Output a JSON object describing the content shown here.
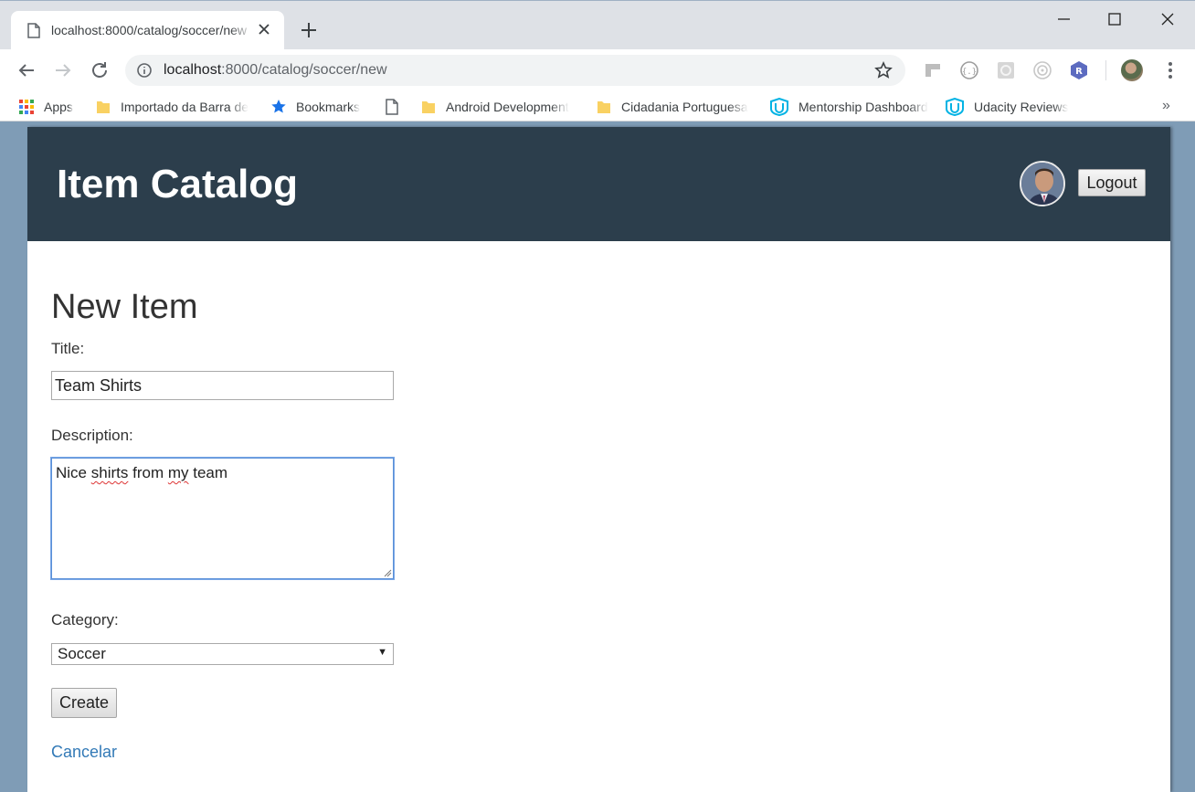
{
  "browser": {
    "tab_title": "localhost:8000/catalog/soccer/new",
    "url_host": "localhost",
    "url_rest": ":8000/catalog/soccer/new"
  },
  "bookmarks": [
    {
      "label": "Apps",
      "icon": "apps-grid-icon"
    },
    {
      "label": "Importado da Barra de",
      "icon": "folder-icon"
    },
    {
      "label": "Bookmarks",
      "icon": "star-icon"
    },
    {
      "label": "",
      "icon": "page-icon"
    },
    {
      "label": "Android Development",
      "icon": "folder-icon"
    },
    {
      "label": "Cidadania Portuguesa",
      "icon": "folder-icon"
    },
    {
      "label": "Mentorship Dashboard",
      "icon": "udacity-icon"
    },
    {
      "label": "Udacity Reviews",
      "icon": "udacity-icon"
    }
  ],
  "bookmarks_more": "»",
  "header": {
    "title": "Item Catalog",
    "logout_label": "Logout"
  },
  "form": {
    "heading": "New Item",
    "title_label": "Title:",
    "title_value": "Team Shirts",
    "description_label": "Description:",
    "description_words": [
      "Nice",
      "shirts",
      "from",
      "my",
      "team"
    ],
    "category_label": "Category:",
    "category_value": "Soccer",
    "create_label": "Create",
    "cancel_label": "Cancelar"
  },
  "colors": {
    "header_bg": "#2c3e4c",
    "link": "#337ab7",
    "page_backdrop": "#7f9cb6"
  }
}
